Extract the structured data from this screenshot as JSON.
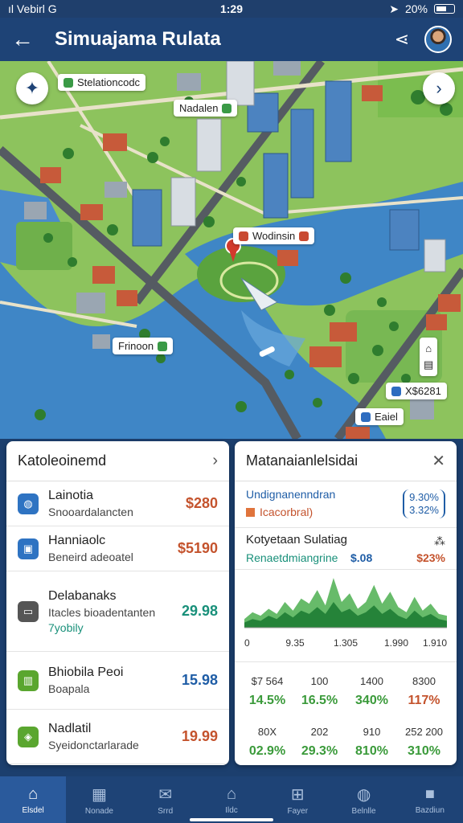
{
  "status": {
    "left": "ıl Vebirl G",
    "time": "1:29",
    "battery": "20%"
  },
  "app": {
    "title": "Simuajama Rulata"
  },
  "map": {
    "labels": {
      "top": "Stelationcodc",
      "district": "Nadalen",
      "center": "Wodinsin",
      "west": "Frinoon",
      "east1": "X$6281",
      "east2": "Eaiel"
    },
    "compass_icon": "compass-icon",
    "next_icon": "chevron-right-icon"
  },
  "left_panel": {
    "title": "Katoleoinemd",
    "rows": [
      {
        "title": "Lainotia",
        "subtitle": "Snooardalancten",
        "value": "$280",
        "color": "#c4532d",
        "icon": "chat-icon",
        "icon_color": "#2e73c2"
      },
      {
        "title": "Hanniaolc",
        "subtitle": "Beneird adeoatel",
        "value": "$5190",
        "color": "#c4532d",
        "icon": "camera-icon",
        "icon_color": "#2e73c2"
      },
      {
        "title": "Delabanaks",
        "subtitle": "Itacles bioadentanten",
        "extra": "7yobily",
        "value": "29.98",
        "color": "#19907a",
        "icon": "card-icon",
        "icon_color": "#555555"
      },
      {
        "title": "Bhiobila Peoi",
        "subtitle": "Boapala",
        "value": "15.98",
        "color": "#1f5da6",
        "icon": "store-icon",
        "icon_color": "#5aa62f"
      },
      {
        "title": "Nadlatil",
        "subtitle": "Syeidonctarlarade",
        "value": "19.99",
        "color": "#c4532d",
        "icon": "shield-icon",
        "icon_color": "#5aa62f"
      }
    ]
  },
  "right_panel": {
    "title": "Matanaianlelsidai",
    "top": {
      "line1": "Undignanenndran",
      "line2": "Icacorbral)",
      "pct1": "9.30%",
      "pct2": "3.32%"
    },
    "mid": {
      "title": "Kotyetaan Sulatiag",
      "s1": "Renaetdmiangrine",
      "s2": "$.08",
      "s3": "$23%"
    },
    "chart_ticks": [
      "0",
      "9.35",
      "1.305",
      "1.990",
      "1.910"
    ],
    "stats_row1": [
      {
        "top": "$7 564",
        "bot": "14.5%",
        "color": "#3a9a3a"
      },
      {
        "top": "100",
        "bot": "16.5%",
        "color": "#3a9a3a"
      },
      {
        "top": "1400",
        "bot": "340%",
        "color": "#3a9a3a"
      },
      {
        "top": "8300",
        "bot": "117%",
        "color": "#c4532d"
      }
    ],
    "stats_row2": [
      {
        "top": "80X",
        "bot": "02.9%",
        "color": "#3a9a3a"
      },
      {
        "top": "202",
        "bot": "29.3%",
        "color": "#3a9a3a"
      },
      {
        "top": "910",
        "bot": "810%",
        "color": "#3a9a3a"
      },
      {
        "top": "252 200",
        "bot": "310%",
        "color": "#3a9a3a"
      }
    ]
  },
  "chart_data": {
    "type": "area",
    "x": [
      0,
      1,
      2,
      3,
      4,
      5,
      6,
      7,
      8,
      9,
      10,
      11,
      12,
      13,
      14,
      15,
      16,
      17,
      18,
      19,
      20,
      21,
      22,
      23,
      24,
      25
    ],
    "series": [
      {
        "values": [
          10,
          18,
          14,
          22,
          16,
          30,
          20,
          34,
          28,
          44,
          26,
          58,
          30,
          40,
          22,
          30,
          50,
          28,
          42,
          24,
          18,
          36,
          20,
          28,
          16,
          14
        ]
      },
      {
        "values": [
          6,
          10,
          8,
          14,
          10,
          18,
          12,
          20,
          16,
          24,
          16,
          30,
          18,
          22,
          14,
          18,
          26,
          16,
          22,
          14,
          10,
          20,
          12,
          16,
          10,
          8
        ]
      }
    ],
    "ylim": [
      0,
      60
    ]
  },
  "nav": [
    {
      "label": "Elsdel",
      "icon": "home-icon",
      "glyph": "⌂"
    },
    {
      "label": "Nonade",
      "icon": "grid-icon",
      "glyph": "▦"
    },
    {
      "label": "Srrd",
      "icon": "inbox-icon",
      "glyph": "✉"
    },
    {
      "label": "Ildc",
      "icon": "house-icon",
      "glyph": "⌂"
    },
    {
      "label": "Fayer",
      "icon": "map-icon",
      "glyph": "⊞"
    },
    {
      "label": "Belnlle",
      "icon": "globe-icon",
      "glyph": "◍"
    },
    {
      "label": "Bazdiun",
      "icon": "square-icon",
      "glyph": "■"
    }
  ]
}
